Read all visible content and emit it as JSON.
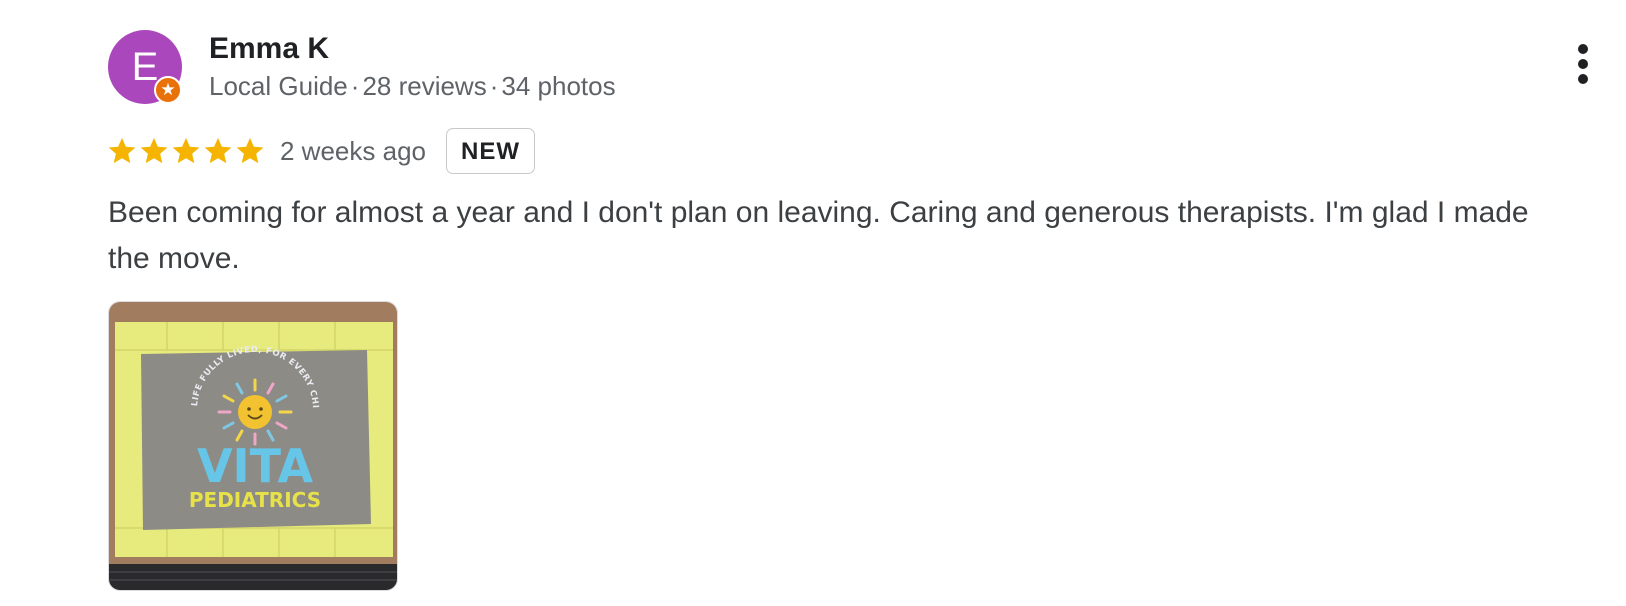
{
  "review": {
    "author": {
      "initial": "E",
      "name": "Emma K",
      "guide_label": "Local Guide",
      "separator": "·",
      "reviews_count": "28 reviews",
      "photos_count": "34 photos",
      "avatar_color": "#ab47bc",
      "badge_color": "#e8710a"
    },
    "rating": {
      "stars": 5,
      "max_stars": 5,
      "star_color": "#f4b400",
      "time_ago": "2 weeks ago",
      "badge": "NEW"
    },
    "text": "Been coming for almost a year and I don't plan on leaving. Caring and generous therapists. I'm glad I made the move.",
    "photo": {
      "sign_arc_text": "LIFE FULLY LIVED, FOR EVERY CHILD",
      "sign_brand": "VITA",
      "sign_subtitle": "PEDIATRICS"
    },
    "more_icon": "more-vert-icon",
    "guide_icon": "star-badge-icon"
  }
}
